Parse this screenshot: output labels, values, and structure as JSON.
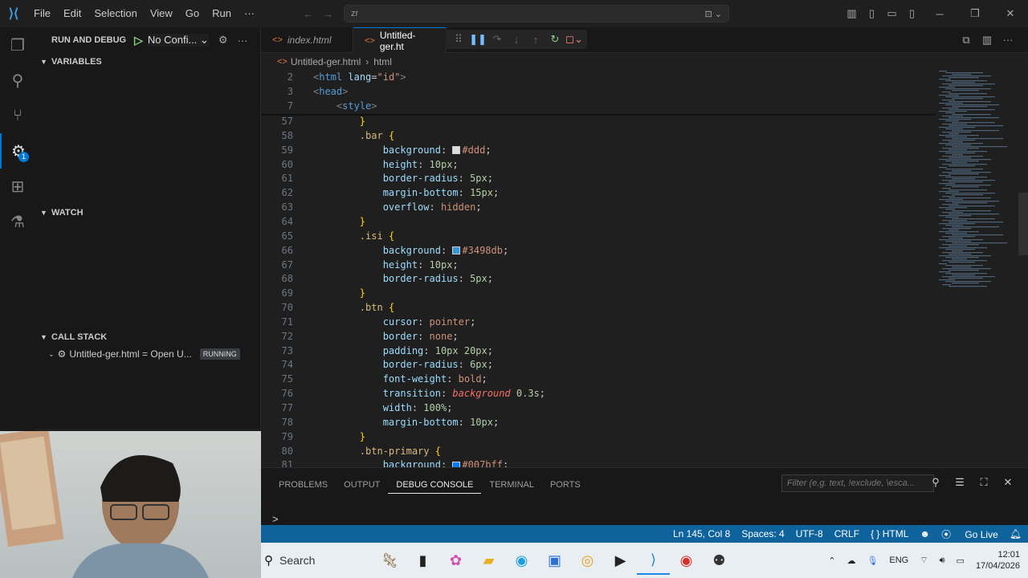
{
  "menu": {
    "items": [
      "File",
      "Edit",
      "Selection",
      "View",
      "Go",
      "Run",
      "···"
    ]
  },
  "command_center": {
    "text": "zr"
  },
  "sidebar": {
    "title": "RUN AND DEBUG",
    "config": "No Confi...",
    "sections": {
      "variables": "VARIABLES",
      "watch": "WATCH",
      "call_stack": "CALL STACK"
    },
    "call_stack_item": {
      "label": "Untitled-ger.html = Open U...",
      "status": "RUNNING"
    },
    "debug_badge": "1"
  },
  "tabs": [
    {
      "label": "index.html"
    },
    {
      "label": "Untitled-ger.ht"
    }
  ],
  "breadcrumb": {
    "file": "Untitled-ger.html",
    "symbol": "html"
  },
  "code": {
    "sticky": [
      {
        "n": "2",
        "t": "<html lang=\"id\">"
      },
      {
        "n": "3",
        "t": "<head>"
      },
      {
        "n": "7",
        "t": "    <style>"
      }
    ],
    "lines": [
      {
        "n": "57",
        "t": "        }"
      },
      {
        "n": "58",
        "t": "        .bar {"
      },
      {
        "n": "59",
        "t": "            background: #ddd;"
      },
      {
        "n": "60",
        "t": "            height: 10px;"
      },
      {
        "n": "61",
        "t": "            border-radius: 5px;"
      },
      {
        "n": "62",
        "t": "            margin-bottom: 15px;"
      },
      {
        "n": "63",
        "t": "            overflow: hidden;"
      },
      {
        "n": "64",
        "t": "        }"
      },
      {
        "n": "65",
        "t": "        .isi {"
      },
      {
        "n": "66",
        "t": "            background: #3498db;"
      },
      {
        "n": "67",
        "t": "            height: 10px;"
      },
      {
        "n": "68",
        "t": "            border-radius: 5px;"
      },
      {
        "n": "69",
        "t": "        }"
      },
      {
        "n": "70",
        "t": "        .btn {"
      },
      {
        "n": "71",
        "t": "            cursor: pointer;"
      },
      {
        "n": "72",
        "t": "            border: none;"
      },
      {
        "n": "73",
        "t": "            padding: 10px 20px;"
      },
      {
        "n": "74",
        "t": "            border-radius: 6px;"
      },
      {
        "n": "75",
        "t": "            font-weight: bold;"
      },
      {
        "n": "76",
        "t": "            transition: background 0.3s;"
      },
      {
        "n": "77",
        "t": "            width: 100%;"
      },
      {
        "n": "78",
        "t": "            margin-bottom: 10px;"
      },
      {
        "n": "79",
        "t": "        }"
      },
      {
        "n": "80",
        "t": "        .btn-primary {"
      },
      {
        "n": "81",
        "t": "            background: #007bff;"
      }
    ]
  },
  "panel": {
    "tabs": [
      "PROBLEMS",
      "OUTPUT",
      "DEBUG CONSOLE",
      "TERMINAL",
      "PORTS"
    ],
    "active_tab": "DEBUG CONSOLE",
    "filter_placeholder": "Filter (e.g. text, !exclude, \\esca...",
    "prompt": ">"
  },
  "status": {
    "position": "Ln 145, Col 8",
    "spaces": "Spaces: 4",
    "encoding": "UTF-8",
    "eol": "CRLF",
    "language": "{ } HTML",
    "golive": "Go Live"
  },
  "taskbar": {
    "search": "Search",
    "lang": "ENG",
    "time": "12:01",
    "date": "17/04/2026"
  },
  "colors": {
    "accent": "#0078d4",
    "statusbar": "#0e639c",
    "editor_bg": "#1f1f1f"
  }
}
